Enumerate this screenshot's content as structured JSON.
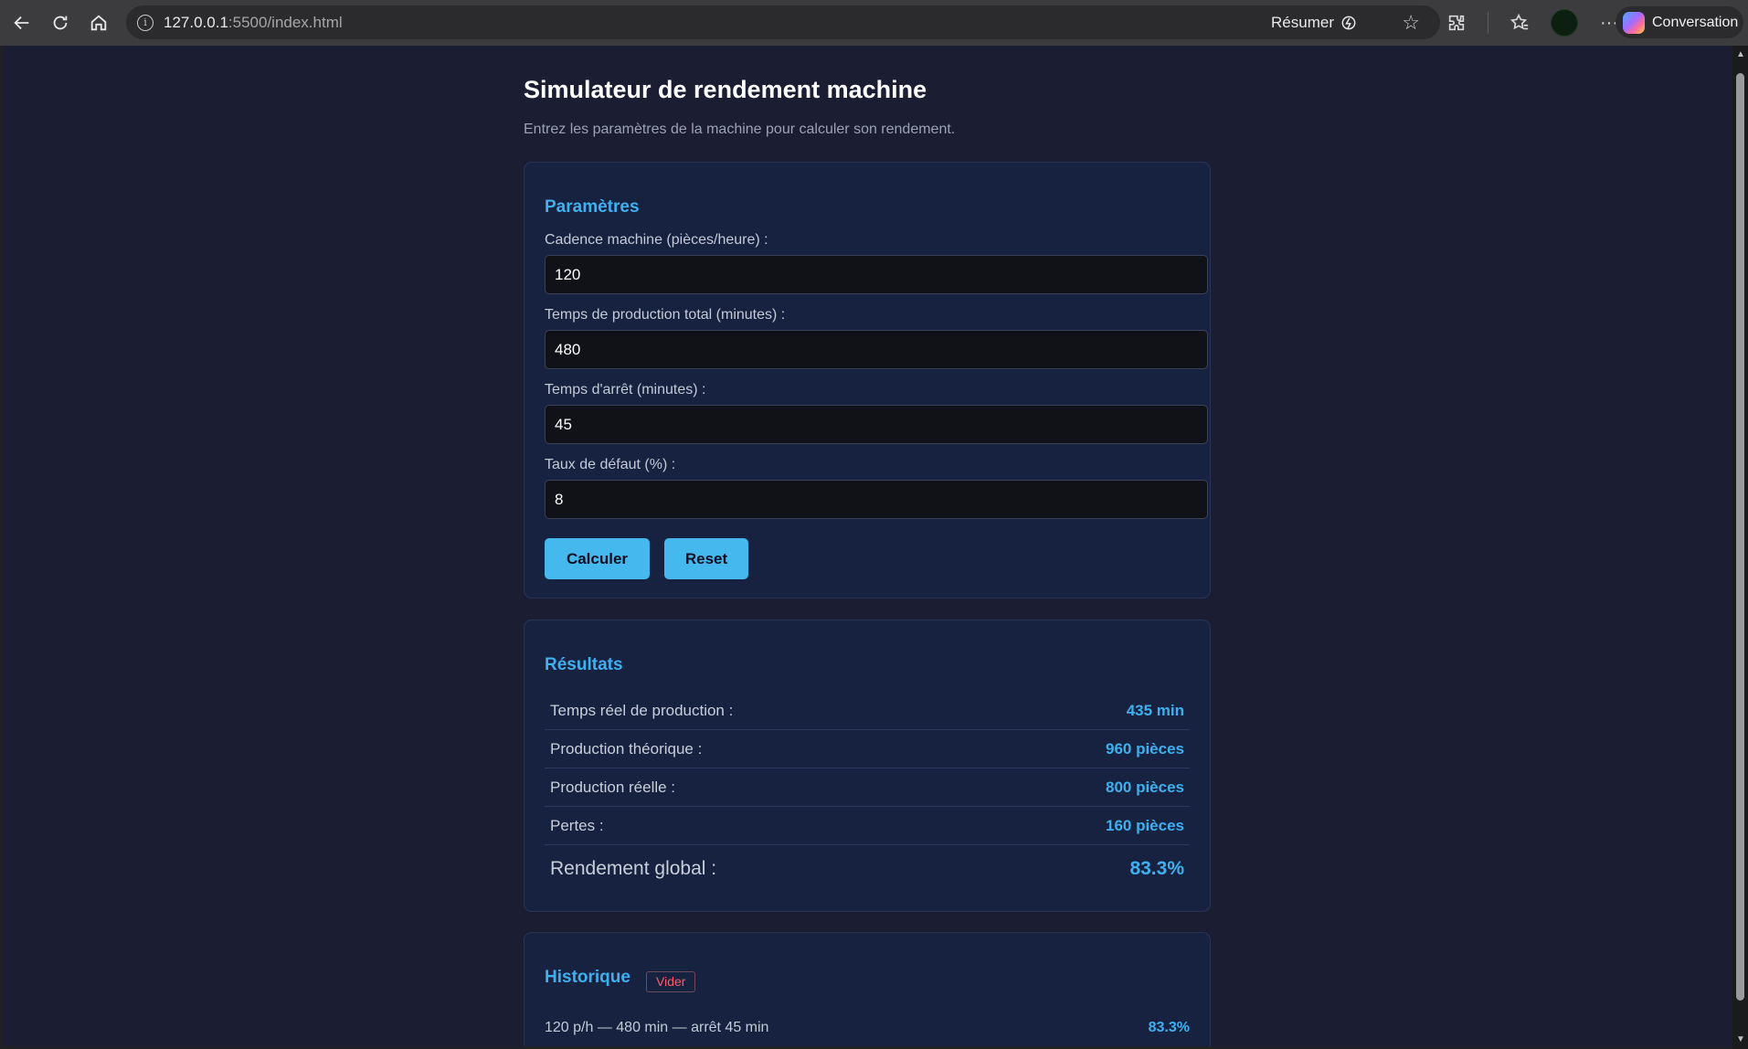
{
  "browser": {
    "url_host": "127.0.0.1",
    "url_path": ":5500/index.html",
    "summarize_label": "Résumer",
    "conversation_label": "Conversation"
  },
  "page": {
    "title": "Simulateur de rendement machine",
    "subtitle": "Entrez les paramètres de la machine pour calculer son rendement."
  },
  "params": {
    "heading": "Paramètres",
    "fields": [
      {
        "label": "Cadence machine (pièces/heure) :",
        "value": "120"
      },
      {
        "label": "Temps de production total (minutes) :",
        "value": "480"
      },
      {
        "label": "Temps d'arrêt (minutes) :",
        "value": "45"
      },
      {
        "label": "Taux de défaut (%) :",
        "value": "8"
      }
    ],
    "calculate_label": "Calculer",
    "reset_label": "Reset"
  },
  "results": {
    "heading": "Résultats",
    "rows": [
      {
        "label": "Temps réel de production :",
        "value": "435 min"
      },
      {
        "label": "Production théorique :",
        "value": "960 pièces"
      },
      {
        "label": "Production réelle :",
        "value": "800 pièces"
      },
      {
        "label": "Pertes :",
        "value": "160 pièces"
      }
    ],
    "global": {
      "label": "Rendement global :",
      "value": "83.3%"
    }
  },
  "history": {
    "heading": "Historique",
    "clear_label": "Vider",
    "entries": [
      {
        "text": "120 p/h — 480 min — arrêt 45 min",
        "value": "83.3%"
      }
    ]
  },
  "colors": {
    "accent": "#3fb0ef",
    "page_bg": "#1b1d33",
    "card_bg": "#172240",
    "button_bg": "#45b8ee",
    "danger": "#ff5a6a"
  }
}
